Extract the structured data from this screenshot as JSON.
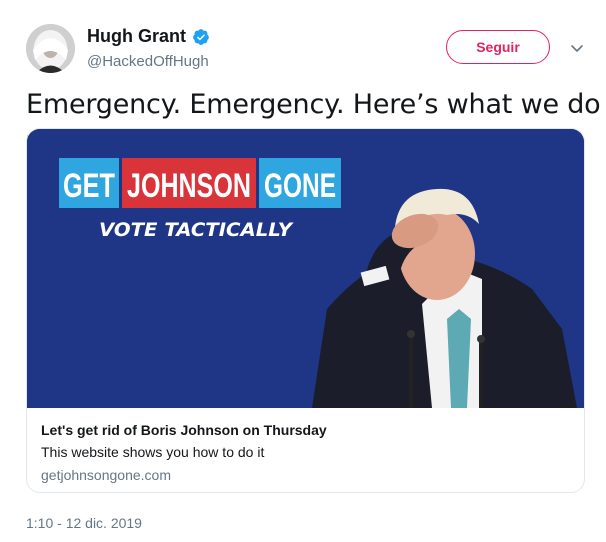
{
  "author": {
    "display_name": "Hugh Grant",
    "handle": "@HackedOffHugh",
    "verified": true
  },
  "follow_button_label": "Seguir",
  "tweet": {
    "text": "Emergency. Emergency. Here’s what we do -",
    "timestamp": "1:10 - 12 dic. 2019"
  },
  "card": {
    "image": {
      "headline_words": [
        "GET",
        "JOHNSON",
        "GONE"
      ],
      "tagline": "VOTE TACTICALLY"
    },
    "title": "Let's get rid of Boris Johnson on Thursday",
    "description": "This website shows you how to do it",
    "domain": "getjohnsongone.com"
  },
  "icons": {
    "verified": "verified-badge-icon",
    "caret": "chevron-down-icon"
  },
  "colors": {
    "follow_accent": "#e0245e",
    "verified_blue": "#1da1f2",
    "card_bg": "#1f3585",
    "headline_blue": "#2fa6e0",
    "headline_red": "#d8343a"
  }
}
